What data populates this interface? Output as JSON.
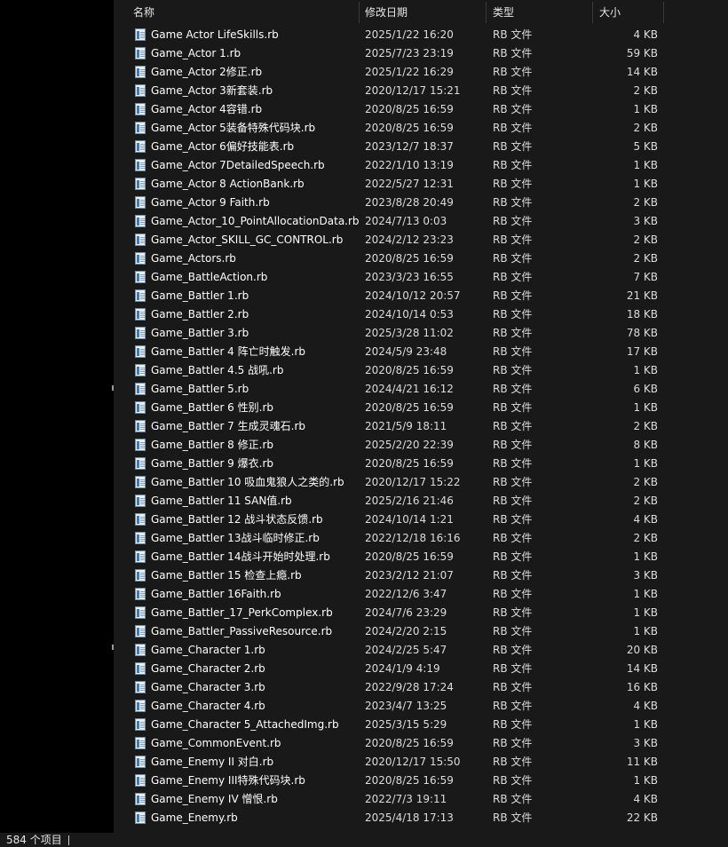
{
  "columns": {
    "name": "名称",
    "date": "修改日期",
    "type": "类型",
    "size": "大小"
  },
  "files": [
    {
      "name": "Game Actor LifeSkills.rb",
      "date": "2025/1/22 16:20",
      "type": "RB 文件",
      "size": "4 KB"
    },
    {
      "name": "Game_Actor 1.rb",
      "date": "2025/7/23 23:19",
      "type": "RB 文件",
      "size": "59 KB"
    },
    {
      "name": "Game_Actor 2修正.rb",
      "date": "2025/1/22 16:29",
      "type": "RB 文件",
      "size": "14 KB"
    },
    {
      "name": "Game_Actor 3新套装.rb",
      "date": "2020/12/17 15:21",
      "type": "RB 文件",
      "size": "2 KB"
    },
    {
      "name": "Game_Actor 4容错.rb",
      "date": "2020/8/25 16:59",
      "type": "RB 文件",
      "size": "1 KB"
    },
    {
      "name": "Game_Actor 5装备特殊代码块.rb",
      "date": "2020/8/25 16:59",
      "type": "RB 文件",
      "size": "2 KB"
    },
    {
      "name": "Game_Actor 6偏好技能表.rb",
      "date": "2023/12/7 18:37",
      "type": "RB 文件",
      "size": "5 KB"
    },
    {
      "name": "Game_Actor 7DetailedSpeech.rb",
      "date": "2022/1/10 13:19",
      "type": "RB 文件",
      "size": "1 KB"
    },
    {
      "name": "Game_Actor 8 ActionBank.rb",
      "date": "2022/5/27 12:31",
      "type": "RB 文件",
      "size": "1 KB"
    },
    {
      "name": "Game_Actor 9 Faith.rb",
      "date": "2023/8/28 20:49",
      "type": "RB 文件",
      "size": "2 KB"
    },
    {
      "name": "Game_Actor_10_PointAllocationData.rb",
      "date": "2024/7/13 0:03",
      "type": "RB 文件",
      "size": "3 KB"
    },
    {
      "name": "Game_Actor_SKILL_GC_CONTROL.rb",
      "date": "2024/2/12 23:23",
      "type": "RB 文件",
      "size": "2 KB"
    },
    {
      "name": "Game_Actors.rb",
      "date": "2020/8/25 16:59",
      "type": "RB 文件",
      "size": "2 KB"
    },
    {
      "name": "Game_BattleAction.rb",
      "date": "2023/3/23 16:55",
      "type": "RB 文件",
      "size": "7 KB"
    },
    {
      "name": "Game_Battler 1.rb",
      "date": "2024/10/12 20:57",
      "type": "RB 文件",
      "size": "21 KB"
    },
    {
      "name": "Game_Battler 2.rb",
      "date": "2024/10/14 0:53",
      "type": "RB 文件",
      "size": "18 KB"
    },
    {
      "name": "Game_Battler 3.rb",
      "date": "2025/3/28 11:02",
      "type": "RB 文件",
      "size": "78 KB"
    },
    {
      "name": "Game_Battler 4 阵亡时触发.rb",
      "date": "2024/5/9 23:48",
      "type": "RB 文件",
      "size": "17 KB"
    },
    {
      "name": "Game_Battler 4.5 战吼.rb",
      "date": "2020/8/25 16:59",
      "type": "RB 文件",
      "size": "1 KB"
    },
    {
      "name": "Game_Battler 5.rb",
      "date": "2024/4/21 16:12",
      "type": "RB 文件",
      "size": "6 KB"
    },
    {
      "name": "Game_Battler 6 性别.rb",
      "date": "2020/8/25 16:59",
      "type": "RB 文件",
      "size": "1 KB"
    },
    {
      "name": "Game_Battler 7 生成灵魂石.rb",
      "date": "2021/5/9 18:11",
      "type": "RB 文件",
      "size": "2 KB"
    },
    {
      "name": "Game_Battler 8 修正.rb",
      "date": "2025/2/20 22:39",
      "type": "RB 文件",
      "size": "8 KB"
    },
    {
      "name": "Game_Battler 9 爆衣.rb",
      "date": "2020/8/25 16:59",
      "type": "RB 文件",
      "size": "1 KB"
    },
    {
      "name": "Game_Battler 10 吸血鬼狼人之类的.rb",
      "date": "2020/12/17 15:22",
      "type": "RB 文件",
      "size": "2 KB"
    },
    {
      "name": "Game_Battler 11 SAN值.rb",
      "date": "2025/2/16 21:46",
      "type": "RB 文件",
      "size": "2 KB"
    },
    {
      "name": "Game_Battler 12 战斗状态反馈.rb",
      "date": "2024/10/14 1:21",
      "type": "RB 文件",
      "size": "4 KB"
    },
    {
      "name": "Game_Battler 13战斗临时修正.rb",
      "date": "2022/12/18 16:16",
      "type": "RB 文件",
      "size": "2 KB"
    },
    {
      "name": "Game_Battler 14战斗开始时处理.rb",
      "date": "2020/8/25 16:59",
      "type": "RB 文件",
      "size": "1 KB"
    },
    {
      "name": "Game_Battler 15 检查上瘾.rb",
      "date": "2023/2/12 21:07",
      "type": "RB 文件",
      "size": "3 KB"
    },
    {
      "name": "Game_Battler 16Faith.rb",
      "date": "2022/12/6 3:47",
      "type": "RB 文件",
      "size": "1 KB"
    },
    {
      "name": "Game_Battler_17_PerkComplex.rb",
      "date": "2024/7/6 23:29",
      "type": "RB 文件",
      "size": "1 KB"
    },
    {
      "name": "Game_Battler_PassiveResource.rb",
      "date": "2024/2/20 2:15",
      "type": "RB 文件",
      "size": "1 KB"
    },
    {
      "name": "Game_Character 1.rb",
      "date": "2024/2/25 5:47",
      "type": "RB 文件",
      "size": "20 KB"
    },
    {
      "name": "Game_Character 2.rb",
      "date": "2024/1/9 4:19",
      "type": "RB 文件",
      "size": "14 KB"
    },
    {
      "name": "Game_Character 3.rb",
      "date": "2022/9/28 17:24",
      "type": "RB 文件",
      "size": "16 KB"
    },
    {
      "name": "Game_Character 4.rb",
      "date": "2023/4/7 13:25",
      "type": "RB 文件",
      "size": "4 KB"
    },
    {
      "name": "Game_Character 5_AttachedImg.rb",
      "date": "2025/3/15 5:29",
      "type": "RB 文件",
      "size": "1 KB"
    },
    {
      "name": "Game_CommonEvent.rb",
      "date": "2020/8/25 16:59",
      "type": "RB 文件",
      "size": "3 KB"
    },
    {
      "name": "Game_Enemy II 对白.rb",
      "date": "2020/12/17 15:50",
      "type": "RB 文件",
      "size": "11 KB"
    },
    {
      "name": "Game_Enemy III特殊代码块.rb",
      "date": "2020/8/25 16:59",
      "type": "RB 文件",
      "size": "1 KB"
    },
    {
      "name": "Game_Enemy IV 憎恨.rb",
      "date": "2022/7/3 19:11",
      "type": "RB 文件",
      "size": "4 KB"
    },
    {
      "name": "Game_Enemy.rb",
      "date": "2025/4/18 17:13",
      "type": "RB 文件",
      "size": "22 KB"
    }
  ],
  "status_bar": {
    "item_count": "584 个项目"
  },
  "colors": {
    "background": "#191919",
    "nav_pane": "#000000",
    "text": "#ffffff",
    "icon_accent": "#3f79b8"
  },
  "icons": {
    "file": "ruby-script-file-icon"
  }
}
